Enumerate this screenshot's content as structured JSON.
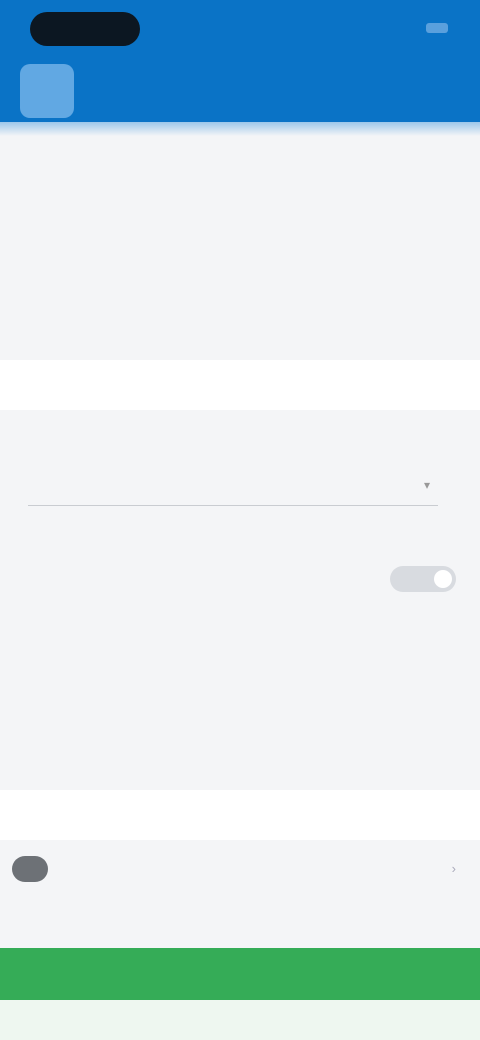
{
  "status_bar": {
    "time": "",
    "indicators": ""
  },
  "app_bar": {
    "title": "",
    "icon": "app-icon"
  },
  "settings": {
    "section_title": "",
    "row_1": {
      "label": "",
      "value": ""
    },
    "row_2": {
      "label": ""
    },
    "row_3": {
      "label": "",
      "sub": ""
    },
    "row_4": {
      "label": ""
    },
    "dropdown": {
      "label": "",
      "value": ""
    },
    "toggle_row": {
      "label": "",
      "state": "off",
      "hint": ""
    },
    "description": "",
    "row_5": {
      "label": "",
      "value": ""
    },
    "row_6": {
      "label": ""
    },
    "link_row": {
      "label": "",
      "arrow": ""
    },
    "sub_link": ""
  },
  "cta": {
    "label": ""
  },
  "colors": {
    "header": "#0a73c6",
    "background": "#f4f5f7",
    "cta": "#35ac57",
    "link": "#2a6bd6"
  }
}
